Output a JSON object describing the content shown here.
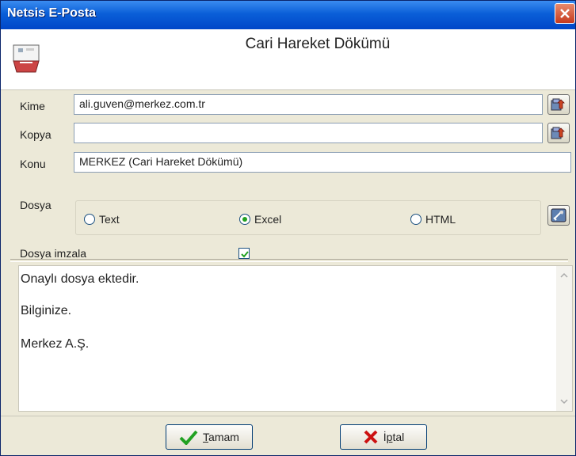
{
  "window": {
    "title": "Netsis E-Posta"
  },
  "header": {
    "title": "Cari Hareket Dökümü"
  },
  "form": {
    "kime_label": "Kime",
    "kime_value": "ali.guven@merkez.com.tr",
    "kopya_label": "Kopya",
    "kopya_value": "",
    "konu_label": "Konu",
    "konu_value": "MERKEZ (Cari Hareket Dökümü)",
    "dosya_label": "Dosya",
    "options": [
      "Text",
      "Excel",
      "HTML"
    ],
    "selected_option": "Excel",
    "imzala_label": "Dosya imzala",
    "imzala_checked": true
  },
  "message": {
    "lines": [
      "Onaylı dosya ektedir.",
      "Bilginize.",
      "Merkez A.Ş."
    ]
  },
  "buttons": {
    "ok_underline": "T",
    "ok_rest": "amam",
    "cancel_first": "İ",
    "cancel_underline": "p",
    "cancel_rest": "tal"
  },
  "colors": {
    "titlebar": "#0a5fd8",
    "accent_green": "#21a121",
    "cancel_red": "#cc1111"
  },
  "icons": [
    "close-icon",
    "mail-icon",
    "address-book-icon",
    "settings-icon",
    "checkmark-icon",
    "cross-icon"
  ]
}
